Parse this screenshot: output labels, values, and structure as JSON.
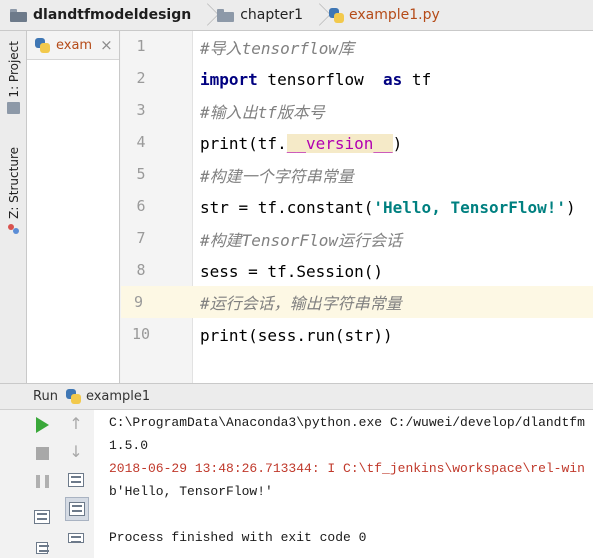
{
  "breadcrumb": {
    "project": "dlandtfmodeldesign",
    "folder": "chapter1",
    "file": "example1.py"
  },
  "left_strip": {
    "project_tab": "1: Project",
    "structure_tab": "Z: Structure"
  },
  "project_panel": {
    "tab_label": "exam",
    "close_glyph": "×"
  },
  "editor": {
    "line_numbers": [
      "1",
      "2",
      "3",
      "4",
      "5",
      "6",
      "7",
      "8",
      "9",
      "10"
    ],
    "current_line": 9,
    "lines": {
      "l1": {
        "comment": "#导入tensorflow库"
      },
      "l2": {
        "kw_import": "import",
        "mod": " tensorflow  ",
        "kw_as": "as",
        "alias": " tf"
      },
      "l3": {
        "comment": "#输入出tf版本号"
      },
      "l4": {
        "a": "print(tf.",
        "magic": "__version__",
        "b": ")"
      },
      "l5": {
        "comment": "#构建一个字符串常量"
      },
      "l6": {
        "a": "str = tf.constant(",
        "str": "'Hello, TensorFlow!'",
        "b": ")"
      },
      "l7": {
        "comment": "#构建TensorFlow运行会话"
      },
      "l8": {
        "code": "sess = tf.Session()"
      },
      "l9": {
        "comment": "#运行会话，输出字符串常量"
      },
      "l10": {
        "code": "print(sess.run(str))"
      }
    }
  },
  "run_panel": {
    "title": "Run",
    "process": "example1",
    "console_lines": [
      "C:\\ProgramData\\Anaconda3\\python.exe C:/wuwei/develop/dlandtfm",
      "1.5.0",
      "2018-06-29 13:48:26.713344: I C:\\tf_jenkins\\workspace\\rel-win",
      "b'Hello, TensorFlow!'",
      "",
      "Process finished with exit code 0"
    ]
  },
  "colors": {
    "run_green": "#3aa83a",
    "file_orange": "#b54b18",
    "keyword": "#000080",
    "string": "#008080",
    "magic": "#b200b2",
    "stderr": "#c0392b"
  }
}
